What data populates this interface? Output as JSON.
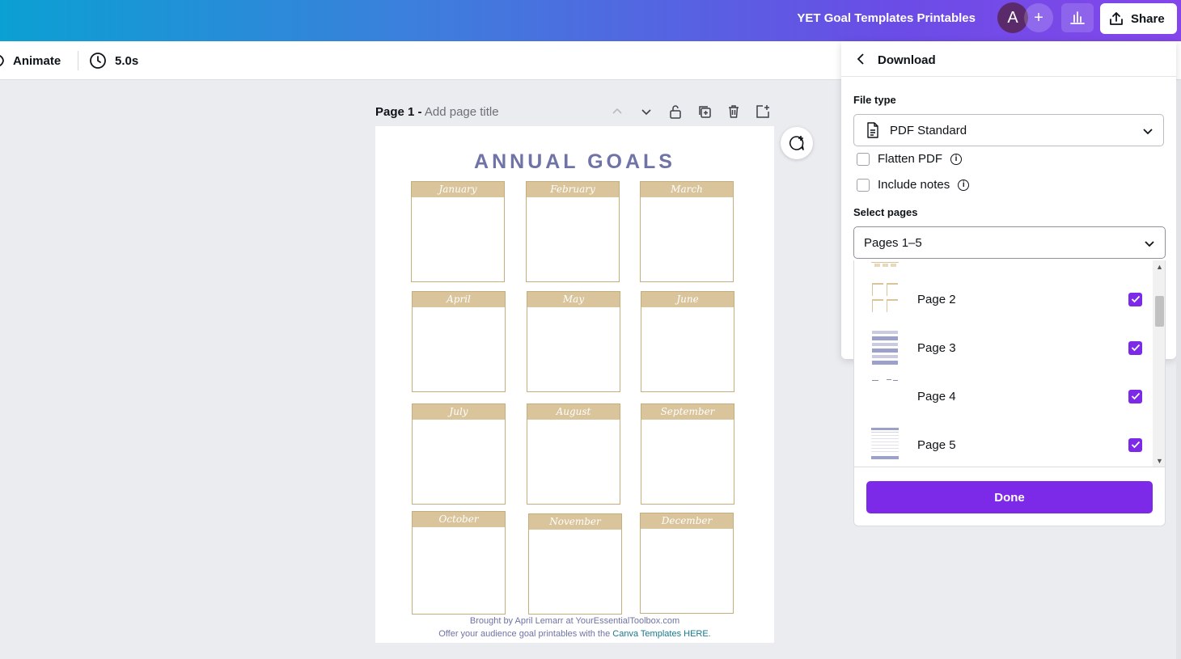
{
  "header": {
    "doc_title": "YET Goal Templates Printables",
    "avatar_letter": "A",
    "plus": "+",
    "share_label": "Share"
  },
  "toolbar": {
    "animate_label": "Animate",
    "duration_label": "5.0s"
  },
  "page": {
    "number_label": "Page 1 -",
    "title_placeholder": "Add page title"
  },
  "design": {
    "title": "ANNUAL GOALS",
    "months": [
      "January",
      "February",
      "March",
      "April",
      "May",
      "June",
      "July",
      "August",
      "September",
      "October",
      "November",
      "December"
    ],
    "footer_line1": "Brought by April Lemarr at YourEssentialToolbox.com",
    "footer_line2_prefix": "Offer your audience goal printables with the",
    "footer_line2_link": "Canva Templates HERE."
  },
  "download": {
    "title": "Download",
    "file_type_label": "File type",
    "file_type_value": "PDF Standard",
    "flatten_label": "Flatten PDF",
    "notes_label": "Include notes",
    "select_pages_label": "Select pages",
    "select_pages_value": "Pages 1–5",
    "pages": [
      {
        "label": "Page 2",
        "checked": true
      },
      {
        "label": "Page 3",
        "checked": true
      },
      {
        "label": "Page 4",
        "checked": true
      },
      {
        "label": "Page 5",
        "checked": true
      }
    ],
    "done_label": "Done"
  },
  "colors": {
    "accent": "#7d2ae8",
    "goal_title": "#6f73a6",
    "month_header": "#d9c49b"
  }
}
